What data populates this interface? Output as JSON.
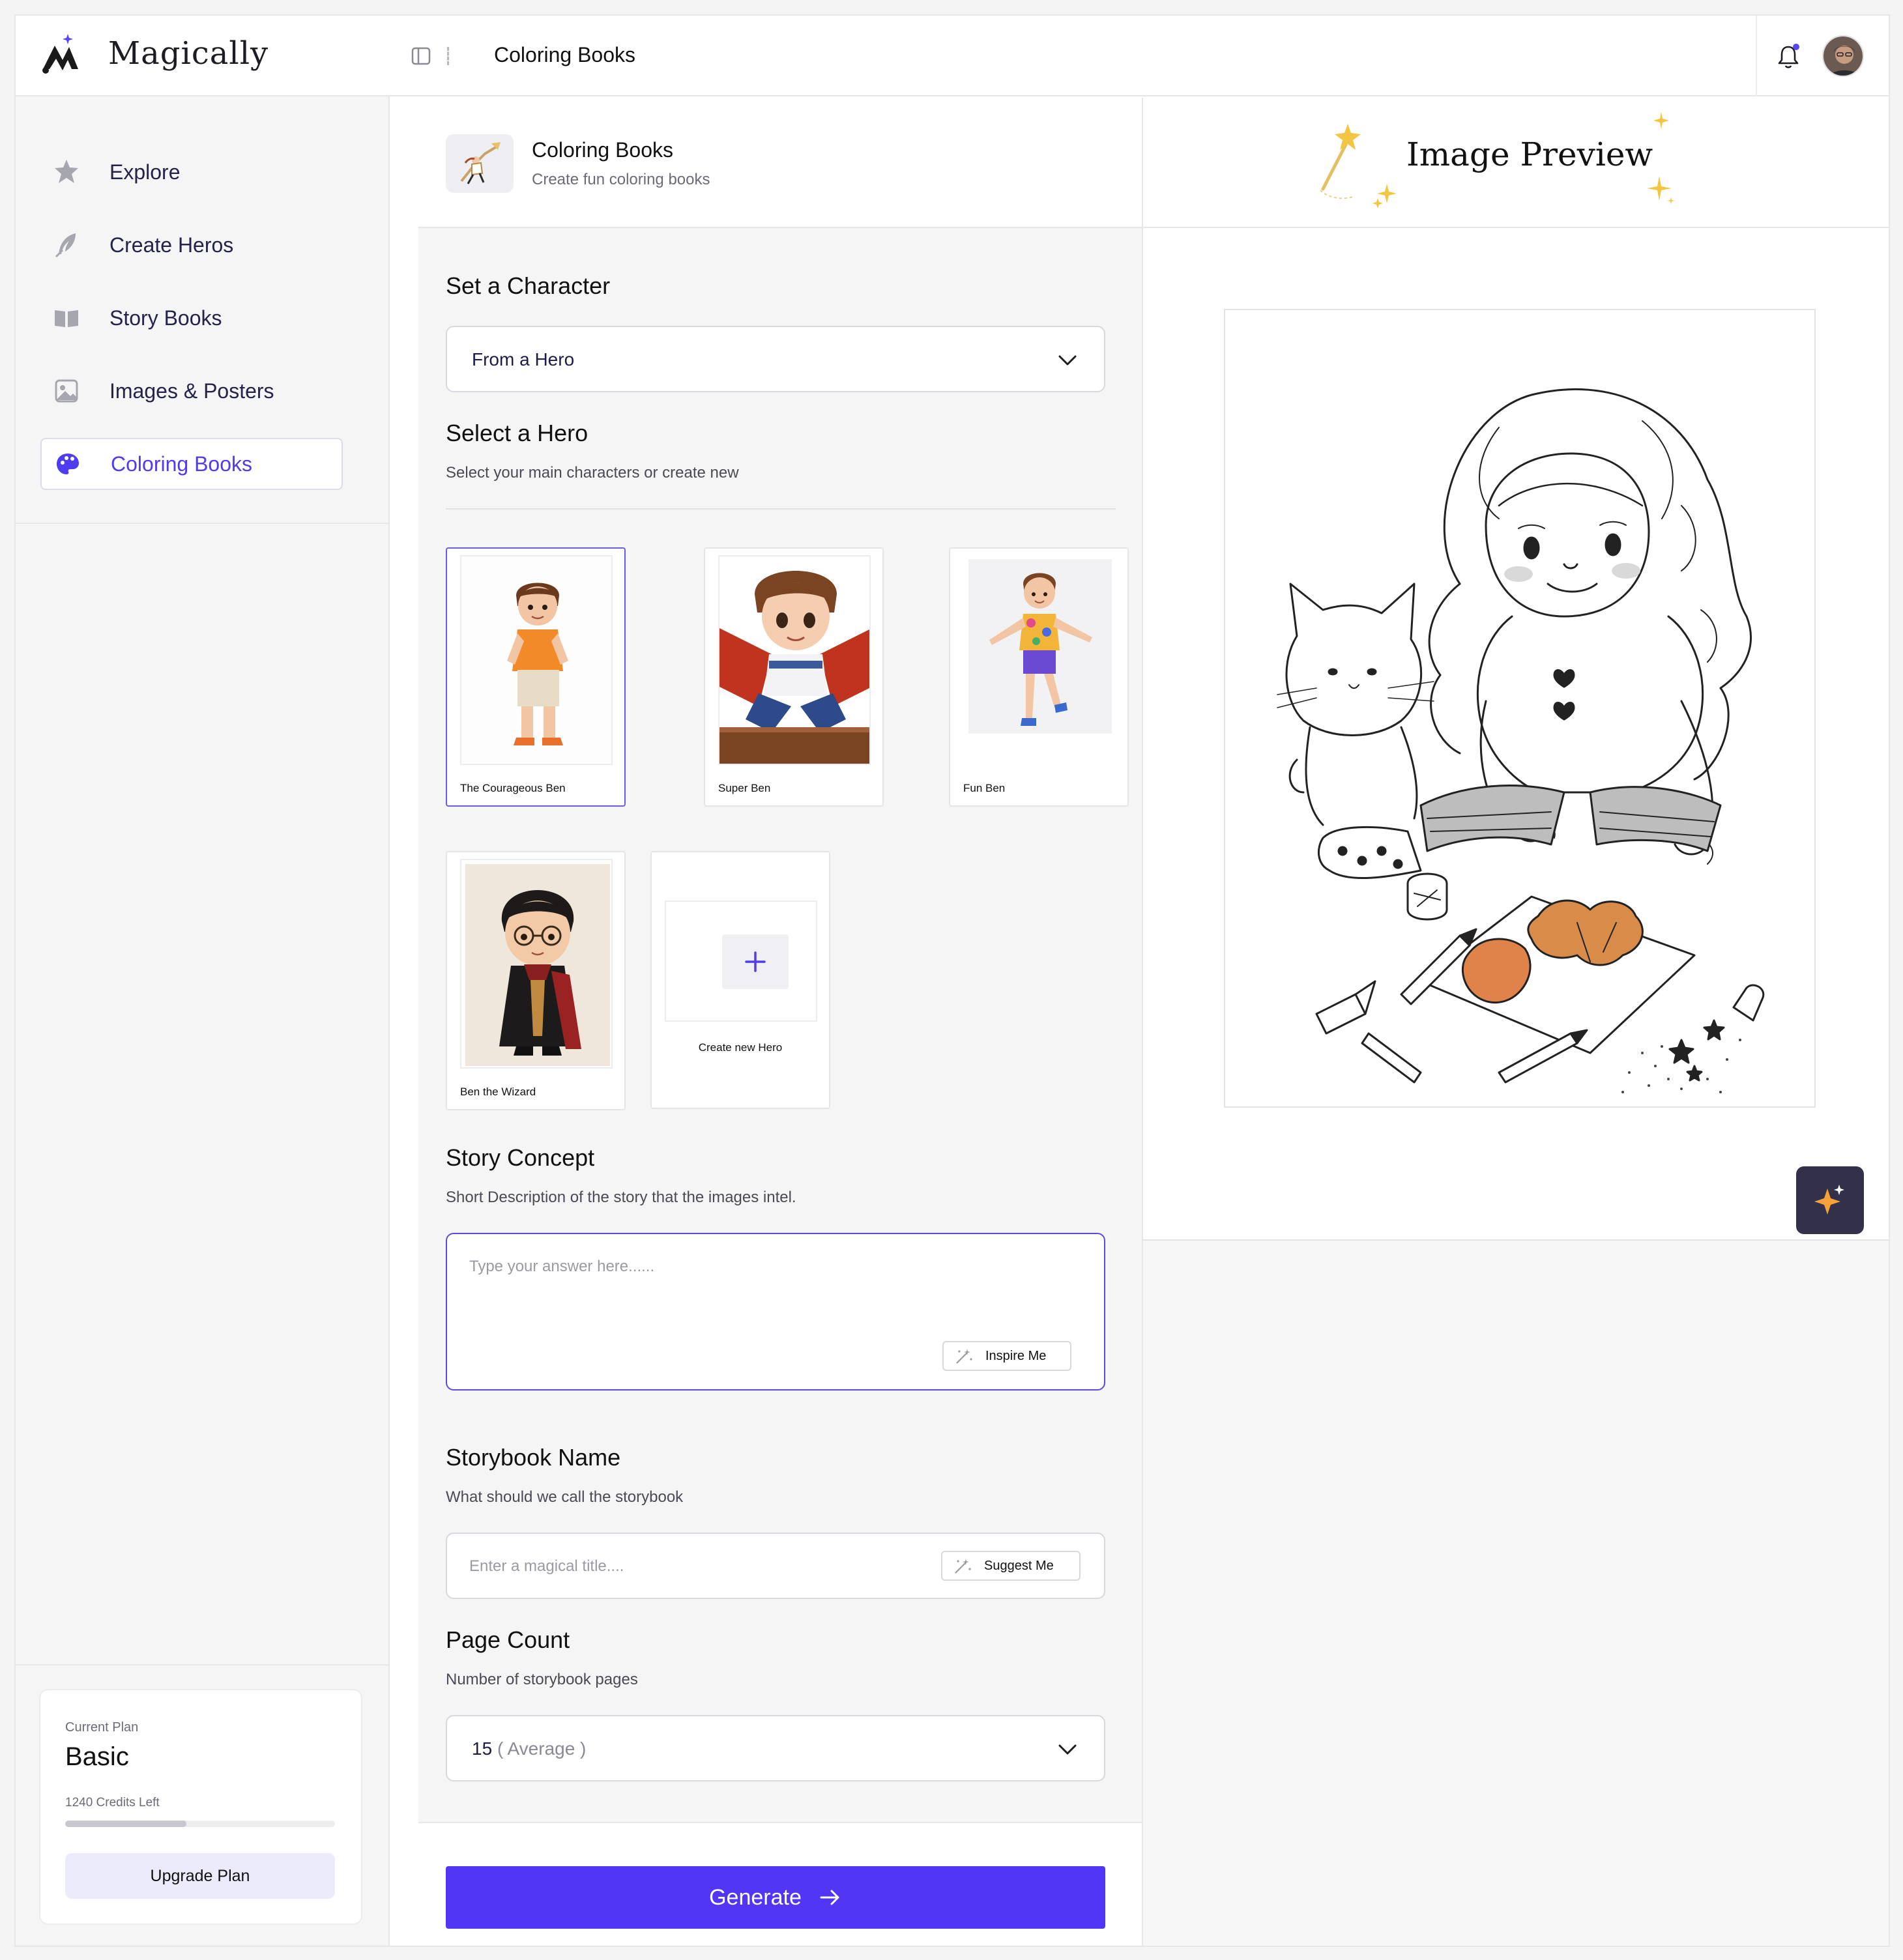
{
  "app": {
    "brand": "Magically"
  },
  "sidebar": {
    "items": [
      {
        "label": "Explore",
        "icon": "star-badge-icon",
        "active": false
      },
      {
        "label": "Create Heros",
        "icon": "feather-icon",
        "active": false
      },
      {
        "label": "Story Books",
        "icon": "book-icon",
        "active": false
      },
      {
        "label": "Images & Posters",
        "icon": "image-icon",
        "active": false
      },
      {
        "label": "Coloring Books",
        "icon": "palette-icon",
        "active": true
      }
    ],
    "plan": {
      "caption": "Current Plan",
      "name": "Basic",
      "credits": "1240 Credits Left",
      "usage_fraction": 0.45,
      "upgrade_label": "Upgrade Plan"
    }
  },
  "topbar": {
    "title": "Coloring Books",
    "notification_dot": true
  },
  "form": {
    "header": {
      "title": "Coloring Books",
      "subtitle": "Create fun coloring books"
    },
    "character": {
      "title": "Set a Character",
      "selected": "From a Hero"
    },
    "hero": {
      "title": "Select a Hero",
      "subtitle": "Select your main characters or create new",
      "cards": [
        {
          "name": "The Courageous Ben",
          "selected": true
        },
        {
          "name": "Super Ben",
          "selected": false
        },
        {
          "name": "Fun Ben",
          "selected": false
        },
        {
          "name": "Ben the Wizard",
          "selected": false
        }
      ],
      "create_label": "Create new Hero"
    },
    "concept": {
      "title": "Story Concept",
      "subtitle": "Short Description of the story that the images intel.",
      "placeholder": "Type your answer here......",
      "inspire_label": "Inspire Me"
    },
    "name": {
      "title": "Storybook Name",
      "subtitle": "What should we call the storybook",
      "placeholder": "Enter a magical title....",
      "suggest_label": "Suggest Me"
    },
    "pages": {
      "title": "Page Count",
      "subtitle": "Number of storybook pages",
      "value": "15",
      "qualifier": "( Average )"
    },
    "generate_label": "Generate"
  },
  "preview": {
    "title": "Image Preview"
  },
  "colors": {
    "accent": "#5236f6",
    "active_text": "#4f3bf0",
    "sparkle": "#f4c542"
  }
}
